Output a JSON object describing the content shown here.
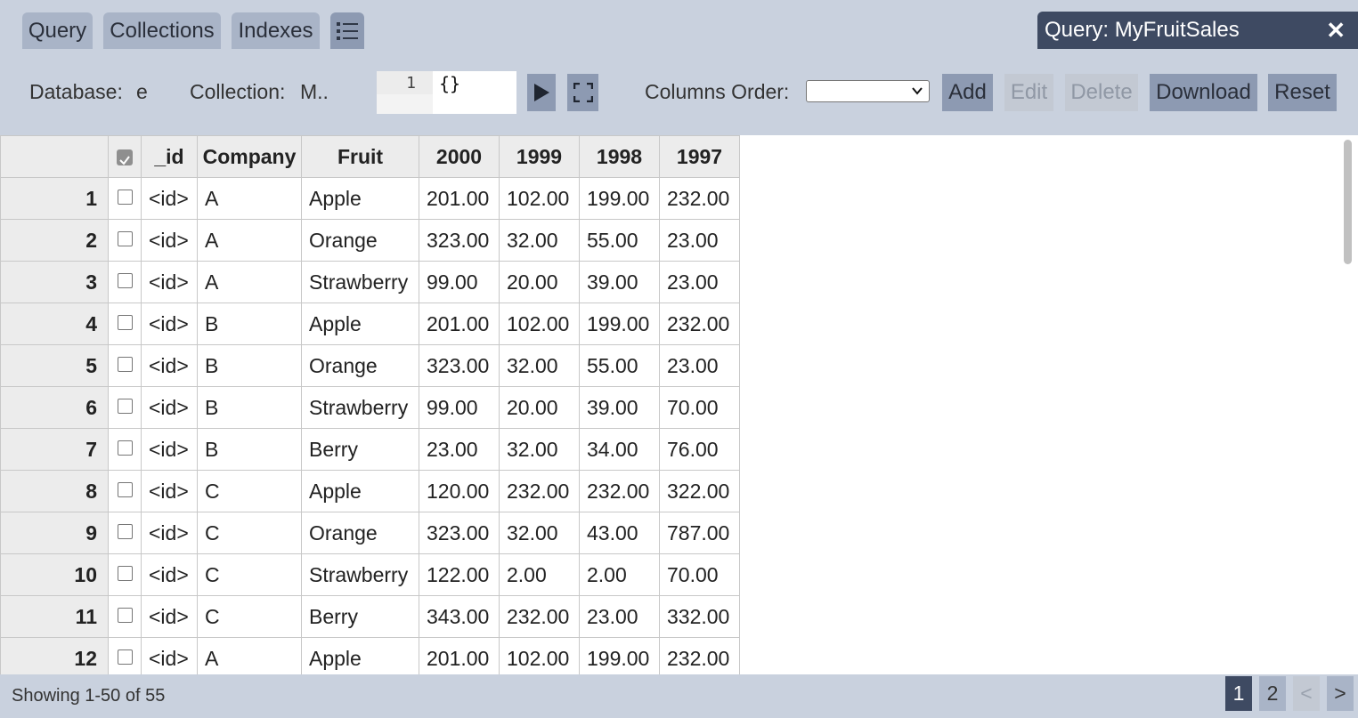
{
  "tabs": [
    {
      "label": "Query"
    },
    {
      "label": "Collections"
    },
    {
      "label": "Indexes"
    }
  ],
  "query_panel": {
    "title": "Query: MyFruitSales",
    "close": "✕"
  },
  "toolbar": {
    "database_label": "Database:",
    "database_value": "e",
    "collection_label": "Collection:",
    "collection_value": "M..",
    "editor_line": "1",
    "editor_code": "{}",
    "columns_order_label": "Columns Order:",
    "columns_order_value": "",
    "add": "Add",
    "edit": "Edit",
    "delete": "Delete",
    "download": "Download",
    "reset": "Reset"
  },
  "grid": {
    "headers": [
      "_id",
      "Company",
      "Fruit",
      "2000",
      "1999",
      "1998",
      "1997"
    ],
    "rows": [
      {
        "n": "1",
        "id": "<id>",
        "company": "A",
        "fruit": "Apple",
        "y2000": "201.00",
        "y1999": "102.00",
        "y1998": "199.00",
        "y1997": "232.00"
      },
      {
        "n": "2",
        "id": "<id>",
        "company": "A",
        "fruit": "Orange",
        "y2000": "323.00",
        "y1999": "32.00",
        "y1998": "55.00",
        "y1997": "23.00"
      },
      {
        "n": "3",
        "id": "<id>",
        "company": "A",
        "fruit": "Strawberry",
        "y2000": "99.00",
        "y1999": "20.00",
        "y1998": "39.00",
        "y1997": "23.00"
      },
      {
        "n": "4",
        "id": "<id>",
        "company": "B",
        "fruit": "Apple",
        "y2000": "201.00",
        "y1999": "102.00",
        "y1998": "199.00",
        "y1997": "232.00"
      },
      {
        "n": "5",
        "id": "<id>",
        "company": "B",
        "fruit": "Orange",
        "y2000": "323.00",
        "y1999": "32.00",
        "y1998": "55.00",
        "y1997": "23.00"
      },
      {
        "n": "6",
        "id": "<id>",
        "company": "B",
        "fruit": "Strawberry",
        "y2000": "99.00",
        "y1999": "20.00",
        "y1998": "39.00",
        "y1997": "70.00"
      },
      {
        "n": "7",
        "id": "<id>",
        "company": "B",
        "fruit": "Berry",
        "y2000": "23.00",
        "y1999": "32.00",
        "y1998": "34.00",
        "y1997": "76.00"
      },
      {
        "n": "8",
        "id": "<id>",
        "company": "C",
        "fruit": "Apple",
        "y2000": "120.00",
        "y1999": "232.00",
        "y1998": "232.00",
        "y1997": "322.00"
      },
      {
        "n": "9",
        "id": "<id>",
        "company": "C",
        "fruit": "Orange",
        "y2000": "323.00",
        "y1999": "32.00",
        "y1998": "43.00",
        "y1997": "787.00"
      },
      {
        "n": "10",
        "id": "<id>",
        "company": "C",
        "fruit": "Strawberry",
        "y2000": "122.00",
        "y1999": "2.00",
        "y1998": "2.00",
        "y1997": "70.00"
      },
      {
        "n": "11",
        "id": "<id>",
        "company": "C",
        "fruit": "Berry",
        "y2000": "343.00",
        "y1999": "232.00",
        "y1998": "23.00",
        "y1997": "332.00"
      },
      {
        "n": "12",
        "id": "<id>",
        "company": "A",
        "fruit": "Apple",
        "y2000": "201.00",
        "y1999": "102.00",
        "y1998": "199.00",
        "y1997": "232.00"
      }
    ]
  },
  "footer": {
    "showing": "Showing 1-50 of 55",
    "pages": [
      "1",
      "2"
    ],
    "prev": "<",
    "next": ">"
  },
  "colors": {
    "accent_dark": "#3e4a62",
    "button": "#8d9ab2",
    "tab": "#a9b4c7",
    "background": "#c9d1de"
  }
}
